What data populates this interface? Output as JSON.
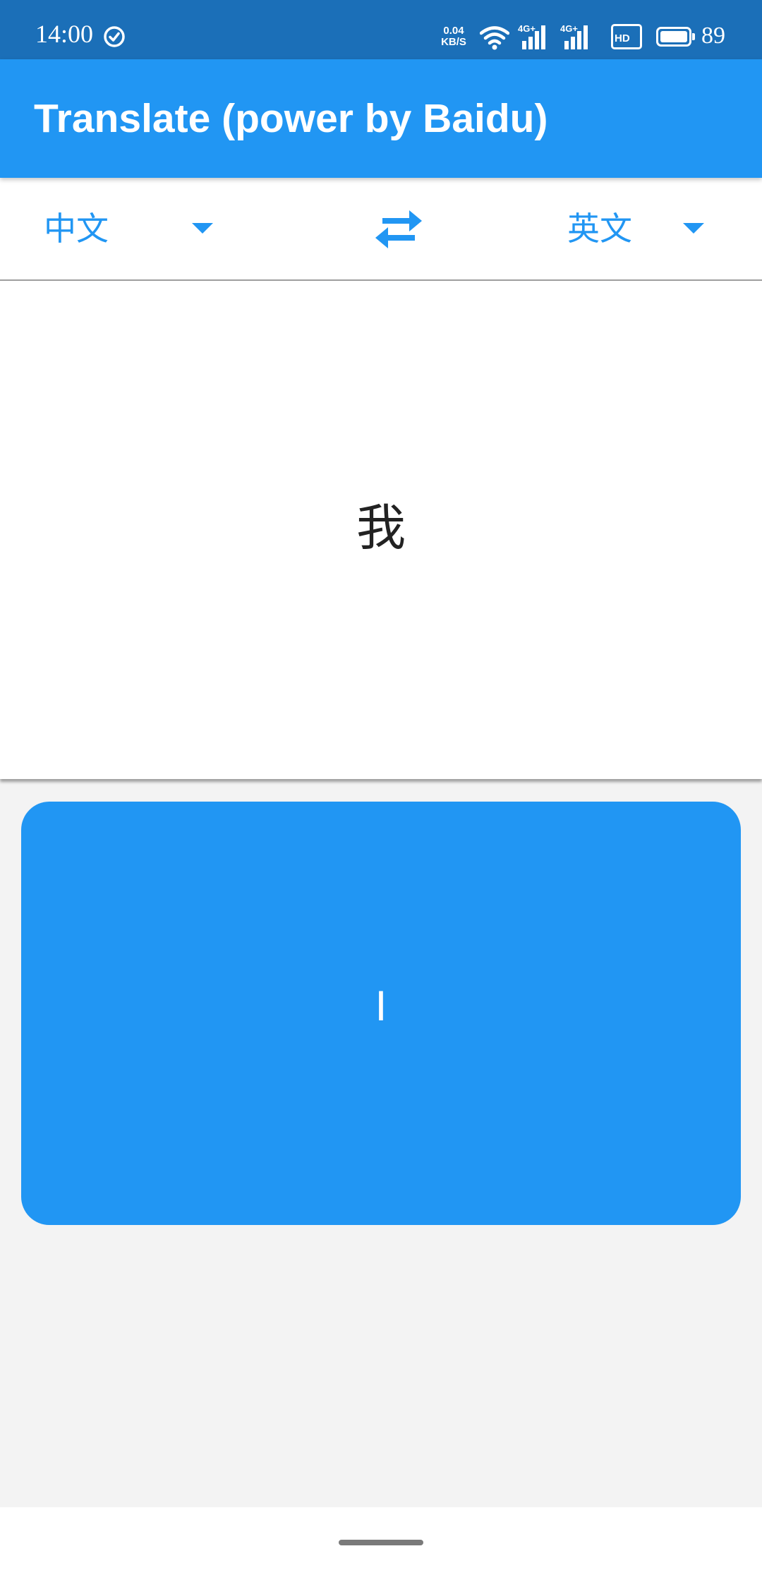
{
  "status_bar": {
    "time": "14:00",
    "net_speed_value": "0.04",
    "net_speed_unit": "KB/S",
    "signal_1_label": "4G+",
    "signal_2_label": "4G+",
    "hd_label": "HD",
    "battery_level": "89",
    "icons": [
      "check-circle-icon",
      "wifi-icon",
      "signal-icon",
      "signal-icon",
      "hd-icon",
      "battery-icon"
    ]
  },
  "app_bar": {
    "title": "Translate (power by Baidu)"
  },
  "language_row": {
    "source_language": "中文",
    "target_language": "英文",
    "swap_icon": "swap-arrows-icon",
    "dropdown_icon": "arrow-drop-down-icon"
  },
  "source": {
    "text": "我"
  },
  "result": {
    "text": "I"
  },
  "colors": {
    "primary": "#2196f3",
    "status_bar": "#1b6fb8",
    "background": "#f3f3f3"
  }
}
